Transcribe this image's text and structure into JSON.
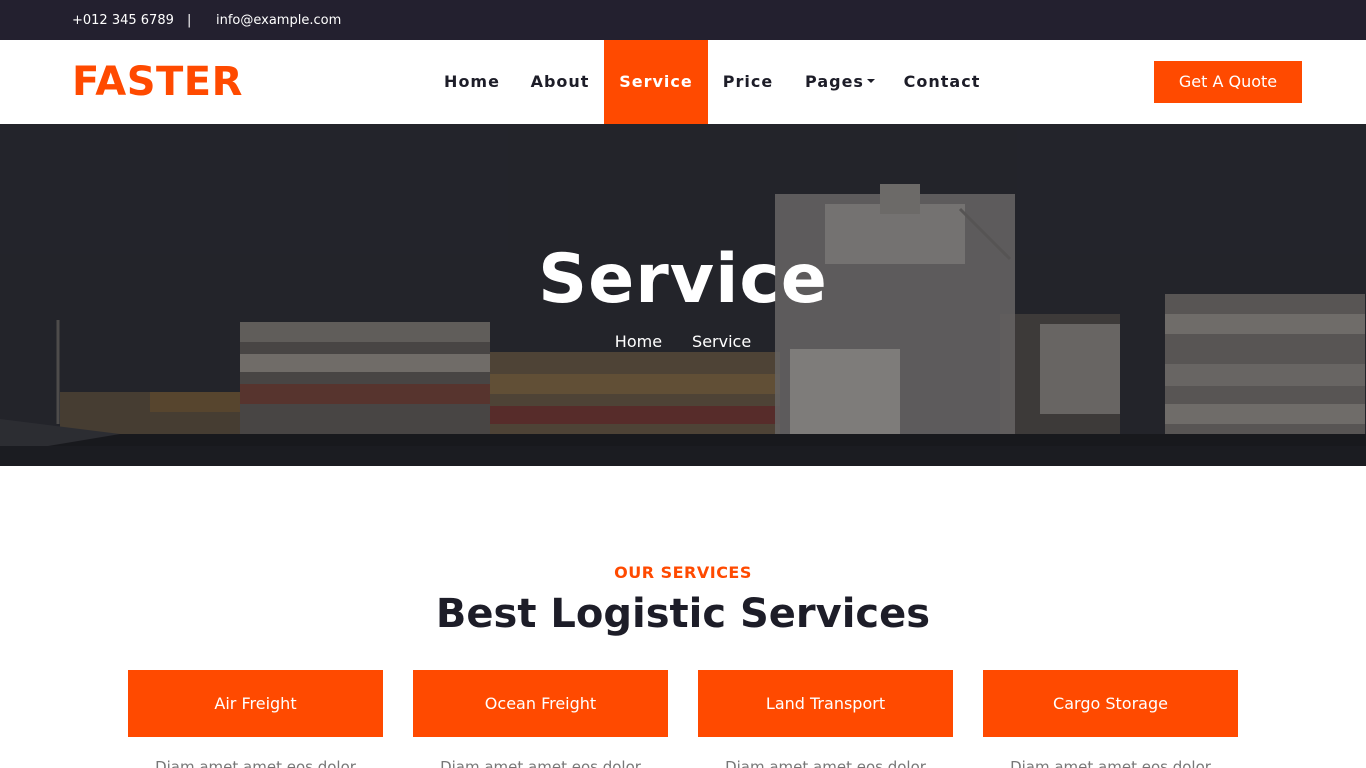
{
  "topbar": {
    "phone": "+012 345 6789",
    "separator": "|",
    "email": "info@example.com"
  },
  "brand": {
    "logo": "FASTER",
    "accent_color": "#ff4a00",
    "dark_color": "#23202f"
  },
  "nav": {
    "items": [
      {
        "label": "Home"
      },
      {
        "label": "About"
      },
      {
        "label": "Service",
        "active": true
      },
      {
        "label": "Price"
      },
      {
        "label": "Pages",
        "dropdown": true
      },
      {
        "label": "Contact"
      }
    ],
    "cta": "Get A Quote"
  },
  "hero": {
    "title": "Service",
    "breadcrumb": [
      "Home",
      "Service"
    ],
    "background": "container cargo ship at sea"
  },
  "services": {
    "label": "OUR SERVICES",
    "title": "Best Logistic Services",
    "cards": [
      {
        "title": "Air Freight",
        "text": "Diam amet amet eos dolor"
      },
      {
        "title": "Ocean Freight",
        "text": "Diam amet amet eos dolor"
      },
      {
        "title": "Land Transport",
        "text": "Diam amet amet eos dolor"
      },
      {
        "title": "Cargo Storage",
        "text": "Diam amet amet eos dolor"
      }
    ]
  }
}
